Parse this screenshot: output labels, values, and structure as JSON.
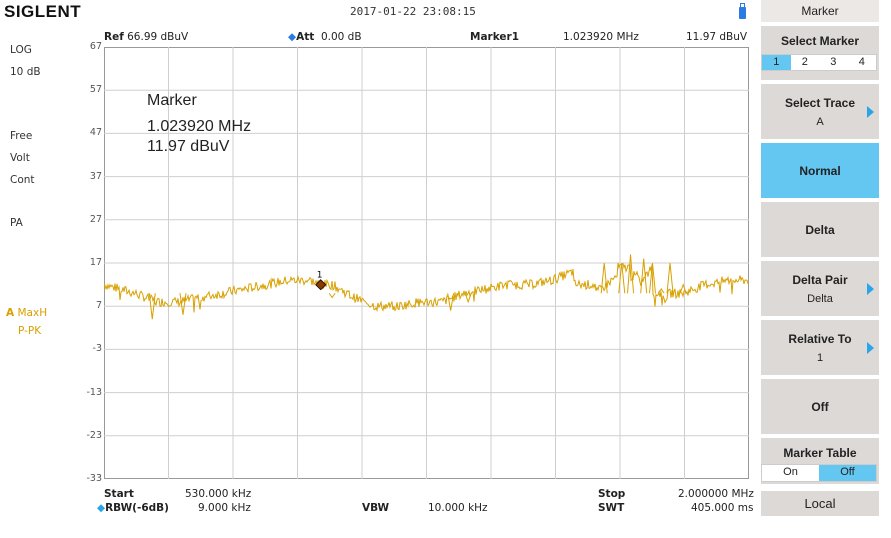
{
  "header": {
    "brand": "SIGLENT",
    "datetime": "2017-01-22  23:08:15",
    "ref_label": "Ref",
    "ref_value": "66.99 dBuV",
    "att_label": "Att",
    "att_value": "0.00 dB",
    "marker_label": "Marker1",
    "marker_freq": "1.023920 MHz",
    "marker_level": "11.97 dBuV"
  },
  "left_panel": {
    "scale": "LOG",
    "div": "10 dB",
    "trigger": "Free",
    "volt": "Volt",
    "sweep": "Cont",
    "preamp": "PA",
    "trace_letter": "A",
    "trace_mode": "MaxH",
    "detector": "P-PK"
  },
  "y_ticks": [
    "67",
    "57",
    "47",
    "37",
    "27",
    "17",
    "7",
    "-3",
    "-13",
    "-23",
    "-33"
  ],
  "marker_annotation": {
    "title": "Marker",
    "freq": "1.023920 MHz",
    "level": "11.97 dBuV",
    "marker_num": "1"
  },
  "footer": {
    "start_label": "Start",
    "start_value": "530.000 kHz",
    "rbw_label": "RBW(-6dB)",
    "rbw_value": "9.000 kHz",
    "vbw_label": "VBW",
    "vbw_value": "10.000 kHz",
    "stop_label": "Stop",
    "stop_value": "2.000000 MHz",
    "swt_label": "SWT",
    "swt_value": "405.000 ms"
  },
  "menu": {
    "title": "Marker",
    "select_marker": "Select Marker",
    "markers": [
      "1",
      "2",
      "3",
      "4"
    ],
    "select_trace": "Select Trace",
    "select_trace_value": "A",
    "normal": "Normal",
    "delta": "Delta",
    "delta_pair": "Delta Pair",
    "delta_pair_value": "Delta",
    "relative_to": "Relative To",
    "relative_to_value": "1",
    "off": "Off",
    "marker_table": "Marker Table",
    "table_on": "On",
    "table_off": "Off",
    "local": "Local"
  },
  "chart_data": {
    "type": "line",
    "x_unit": "MHz",
    "y_unit": "dBuV",
    "xlim": [
      0.53,
      2.0
    ],
    "ylim": [
      -33,
      67
    ],
    "grid": true,
    "series": [
      {
        "color": "#d8a000",
        "x": [
          0.53,
          0.6,
          0.65,
          0.7,
          0.75,
          0.8,
          0.85,
          0.9,
          0.95,
          1.0,
          1.02392,
          1.05,
          1.1,
          1.15,
          1.2,
          1.25,
          1.3,
          1.35,
          1.4,
          1.45,
          1.5,
          1.55,
          1.6,
          1.65,
          1.7,
          1.73,
          1.75,
          1.78,
          1.8,
          1.82,
          1.85,
          1.9,
          1.95,
          2.0
        ],
        "y": [
          12,
          10,
          8,
          8,
          9,
          10,
          11,
          12,
          13,
          13,
          11.97,
          12,
          9,
          7,
          7,
          8,
          8,
          10,
          11,
          12,
          12,
          13,
          15,
          10,
          14,
          19,
          12,
          16,
          8,
          10,
          10,
          12,
          13,
          13
        ]
      }
    ],
    "marker": {
      "x": 1.02392,
      "y": 11.97,
      "label": "1"
    }
  }
}
